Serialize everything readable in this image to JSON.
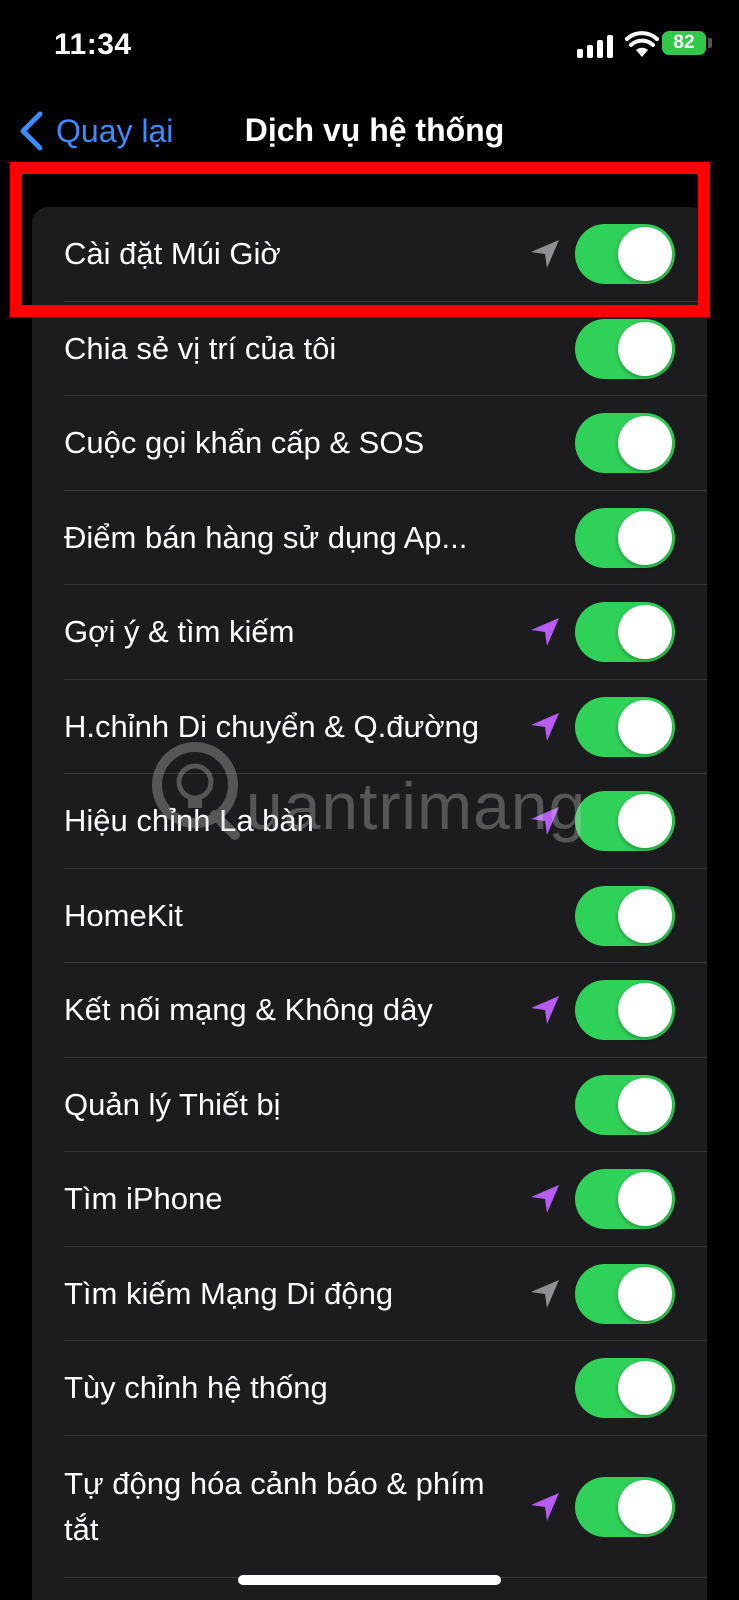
{
  "status_bar": {
    "time": "11:34",
    "battery": "82",
    "icons": [
      "signal-icon",
      "wifi-icon",
      "battery-icon"
    ]
  },
  "nav": {
    "back_label": "Quay lại",
    "title": "Dịch vụ hệ thống"
  },
  "colors": {
    "accent": "#3a8cff",
    "toggle_on": "#30d158",
    "arrow_purple": "#b65cf5",
    "arrow_gray": "#8e8e93",
    "highlight_box": "#ff0000"
  },
  "rows": [
    {
      "label": "Cài đặt Múi Giờ",
      "arrow": "gray",
      "on": true
    },
    {
      "label": "Chia sẻ vị trí của tôi",
      "arrow": "none",
      "on": true
    },
    {
      "label": "Cuộc gọi khẩn cấp & SOS",
      "arrow": "none",
      "on": true
    },
    {
      "label": "Điểm bán hàng sử dụng Ap...",
      "arrow": "none",
      "on": true
    },
    {
      "label": "Gợi ý & tìm kiếm",
      "arrow": "purple",
      "on": true
    },
    {
      "label": "H.chỉnh Di chuyển & Q.đường",
      "arrow": "purple",
      "on": true
    },
    {
      "label": "Hiệu chỉnh La bàn",
      "arrow": "purple",
      "on": true
    },
    {
      "label": "HomeKit",
      "arrow": "none",
      "on": true
    },
    {
      "label": "Kết nối mạng & Không dây",
      "arrow": "purple",
      "on": true
    },
    {
      "label": "Quản lý Thiết bị",
      "arrow": "none",
      "on": true
    },
    {
      "label": "Tìm iPhone",
      "arrow": "purple",
      "on": true
    },
    {
      "label": "Tìm kiếm Mạng Di động",
      "arrow": "gray",
      "on": true
    },
    {
      "label": "Tùy chỉnh hệ thống",
      "arrow": "none",
      "on": true
    },
    {
      "label": "Tự động hóa cảnh báo & phím tắt",
      "arrow": "purple",
      "on": true
    }
  ],
  "watermark": {
    "text": "uantrimang"
  }
}
